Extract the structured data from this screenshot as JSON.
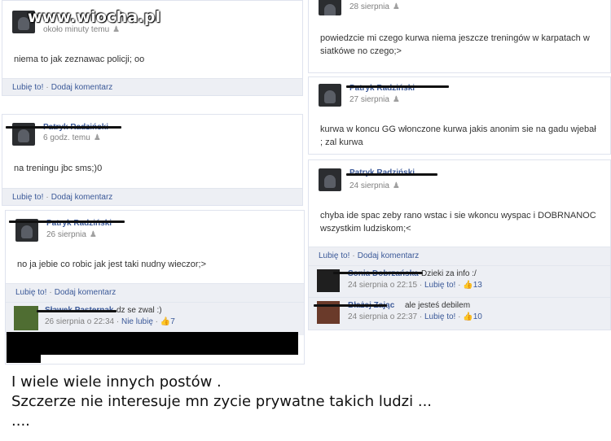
{
  "watermark": "www.wiocha.pl",
  "posts": [
    {
      "meta": "około minuty temu",
      "message": "niema to jak zeznawac policji; oo",
      "like": "Lubię to!",
      "comment": "Dodaj komentarz"
    },
    {
      "name": "Patryk Radziński",
      "meta": "6 godz. temu",
      "message": "na treningu jbc sms;)0",
      "like": "Lubię to!",
      "comment": "Dodaj komentarz"
    },
    {
      "name": "Patryk Radziński",
      "meta": "26 sierpnia",
      "message": "no ja jebie co robic jak jest taki nudny wieczor;>",
      "like": "Lubię to!",
      "comment": "Dodaj komentarz",
      "reply": {
        "name": "Sławek Pasternak",
        "text": "dz se zwal :)",
        "time": "26 sierpnia o 22:34",
        "unlike": "Nie lubię",
        "count": "7"
      }
    },
    {
      "meta": "28 sierpnia",
      "message": "powiedzcie mi czego kurwa niema jeszcze treningów w karpatach w siatkówe no czego;>"
    },
    {
      "name": "Patryk Radziński",
      "meta": "27 sierpnia",
      "message": "kurwa w koncu GG włonczone kurwa jakis anonim sie na gadu wjebał ; zal kurwa"
    },
    {
      "name": "Patryk Radziński",
      "meta": "24 sierpnia",
      "message": "chyba ide spac zeby rano wstac i sie wkoncu wyspac i DOBRNANOC wszystkim ludziskom;<",
      "like": "Lubię to!",
      "comment": "Dodaj komentarz",
      "replies": [
        {
          "name": "Sonia Dobrzańska",
          "text": "Dzieki za info :/",
          "time": "24 sierpnia o 22:15",
          "like": "Lubię to!",
          "count": "13"
        },
        {
          "name": "Błażej Zając",
          "text": "ale jesteś debilem",
          "time": "24 sierpnia o 22:37",
          "like": "Lubię to!",
          "count": "10"
        }
      ]
    }
  ],
  "caption": {
    "line1": "I wiele wiele innych postów .",
    "line2": "Szczerze nie interesuje mn zycie prywatne takich ludzi ...",
    "line3": "...."
  }
}
